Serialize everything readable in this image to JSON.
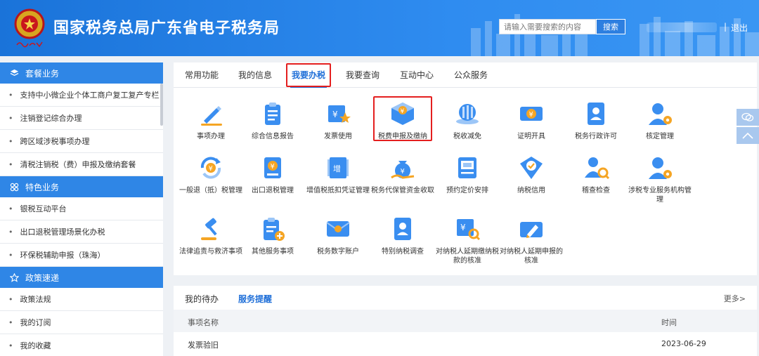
{
  "header": {
    "title": "国家税务总局广东省电子税务局",
    "search_placeholder": "请输入需要搜索的内容",
    "search_button": "搜索",
    "separator": "|",
    "logout": "退出",
    "brand_color": "#2f86e6"
  },
  "sidebar": {
    "groups": [
      {
        "title": "套餐业务",
        "icon": "layers-icon",
        "items": [
          "支持中小微企业个体工商户复工复产专栏",
          "注销登记综合办理",
          "跨区域涉税事项办理",
          "清税注销税（费）申报及缴纳套餐"
        ]
      },
      {
        "title": "特色业务",
        "icon": "grid-icon",
        "items": [
          "银税互动平台",
          "出口退税管理场景化办税",
          "环保税辅助申报（珠海）"
        ]
      },
      {
        "title": "政策速递",
        "icon": "star-icon",
        "items": [
          "政策法规",
          "我的订阅",
          "我的收藏"
        ]
      }
    ]
  },
  "tabs": [
    "常用功能",
    "我的信息",
    "我要办税",
    "我要查询",
    "互动中心",
    "公众服务"
  ],
  "active_tab": "我要办税",
  "services": [
    {
      "label": "事项办理",
      "icon": "pen-icon"
    },
    {
      "label": "综合信息报告",
      "icon": "clipboard-icon"
    },
    {
      "label": "发票使用",
      "icon": "invoice-star-icon"
    },
    {
      "label": "税费申报及缴纳",
      "icon": "yuan-box-icon"
    },
    {
      "label": "税收减免",
      "icon": "coins-icon"
    },
    {
      "label": "证明开具",
      "icon": "yuan-ticket-icon"
    },
    {
      "label": "税务行政许可",
      "icon": "badge-user-icon"
    },
    {
      "label": "核定管理",
      "icon": "user-gear-icon"
    },
    {
      "label": "一般退（抵）税管理",
      "icon": "yuan-refresh-icon"
    },
    {
      "label": "出口退税管理",
      "icon": "yuan-book-icon"
    },
    {
      "label": "增值税抵扣凭证管理",
      "icon": "vat-ticket-icon"
    },
    {
      "label": "税务代保管资金收取",
      "icon": "money-bag-icon"
    },
    {
      "label": "预约定价安排",
      "icon": "document-icon"
    },
    {
      "label": "纳税信用",
      "icon": "shield-check-icon"
    },
    {
      "label": "稽查检查",
      "icon": "user-search-icon"
    },
    {
      "label": "涉税专业服务机构管理",
      "icon": "user-gear-icon"
    },
    {
      "label": "法律追责与救济事项",
      "icon": "gavel-icon"
    },
    {
      "label": "其他服务事项",
      "icon": "clipboard-plus-icon"
    },
    {
      "label": "税务数字账户",
      "icon": "mail-user-icon"
    },
    {
      "label": "特别纳税调查",
      "icon": "badge-user-icon"
    },
    {
      "label": "对纳税人延期缴纳税款的核准",
      "icon": "yuan-search-icon"
    },
    {
      "label": "对纳税人延期申报的核准",
      "icon": "ticket-pen-icon"
    }
  ],
  "bottom": {
    "tabs": [
      "我的待办",
      "服务提醒"
    ],
    "active_tab": "服务提醒",
    "more": "更多>",
    "columns": [
      "事项名称",
      "时间"
    ],
    "rows": [
      {
        "name": "发票验旧",
        "time": "2023-06-29"
      }
    ]
  },
  "colors": {
    "accent": "#1f6fd8",
    "icon_blue": "#3a8ef0",
    "icon_orange": "#f5a524",
    "highlight": "#e41f1f"
  }
}
